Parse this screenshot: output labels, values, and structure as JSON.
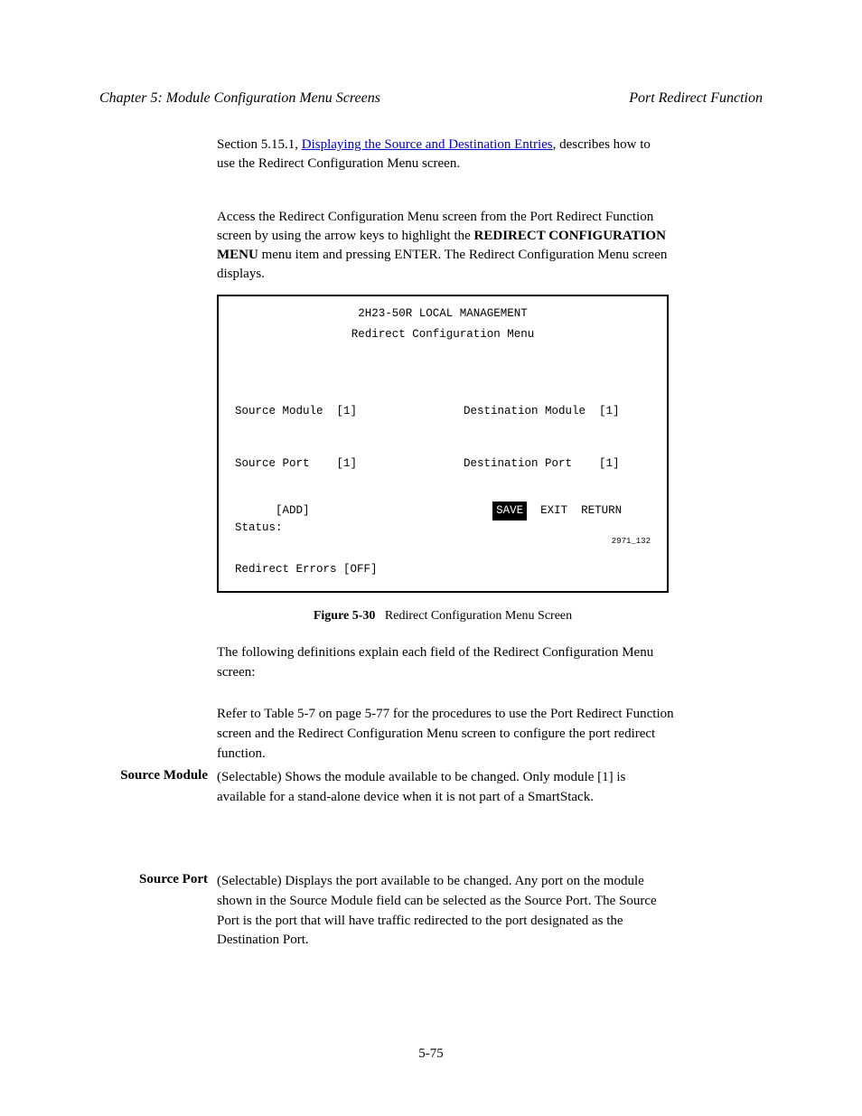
{
  "header": {
    "left": "Chapter 5: Module Configuration Menu Screens",
    "right": "Port Redirect Function"
  },
  "intro": {
    "prefix": "Section 5.15.1, ",
    "link_text": "Displaying the Source and Destination Entries",
    "suffix": ", describes how to use the Redirect Configuration Menu screen."
  },
  "accessing": {
    "prefix": "Access the Redirect Configuration Menu screen from the Port Redirect Function screen by using the arrow keys to highlight the ",
    "bold": "REDIRECT CONFIGURATION MENU",
    "suffix": " menu item and pressing ENTER. The Redirect Configuration Menu screen displays."
  },
  "screen": {
    "title": "2H23-50R LOCAL MANAGEMENT",
    "subtitle": "Redirect Configuration Menu",
    "leftcol": [
      "Source Module  [1]               ",
      "Source Port    [1]               ",
      "Redirect Errors [OFF]            "
    ],
    "rightcol": [
      "Destination Module  [1]",
      "Destination Port    [1]",
      " "
    ],
    "bottom_label": "Status:",
    "footer_left": "[ADD]",
    "footer_exit": "EXIT",
    "save_label": "SAVE",
    "footer_return": "RETURN",
    "footer_ref": "2971_132"
  },
  "figure": {
    "number": "Figure 5-30",
    "caption": "Redirect Configuration Menu Screen"
  },
  "body": {
    "p1": "The following definitions explain each field of the Redirect Configuration Menu screen:",
    "p2": "Refer to Table 5-7 on page 5-77 for the procedures to use the Port Redirect Function screen and the Redirect Configuration Menu screen to configure the port redirect function."
  },
  "sideHeadings": {
    "h1": "Source Module",
    "h2": "Source Port"
  },
  "sideBodies": {
    "b1": "(Selectable) Shows the module available to be changed. Only module [1] is available for a stand-alone device when it is not part of a SmartStack.",
    "b2": "(Selectable) Displays the port available to be changed. Any port on the module shown in the Source Module field can be selected as the Source Port. The Source Port is the port that will have traffic redirected to the port designated as the Destination Port."
  },
  "pageNumber": "5-75"
}
